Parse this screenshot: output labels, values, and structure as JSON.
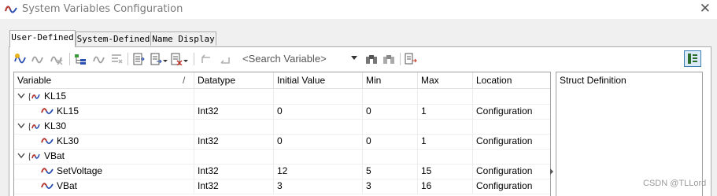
{
  "window": {
    "title": "System Variables Configuration"
  },
  "tabs": [
    {
      "label": "User-Defined",
      "active": true
    },
    {
      "label": "System-Defined",
      "active": false
    },
    {
      "label": "Name Display",
      "active": false
    }
  ],
  "toolbar": {
    "search_placeholder": "<Search Variable>"
  },
  "grid": {
    "columns": [
      "Variable",
      "Datatype",
      "Initial Value",
      "Min",
      "Max",
      "Location"
    ],
    "sort_indicator": "/",
    "rows": [
      {
        "kind": "namespace",
        "name": "KL15",
        "datatype": "",
        "initial": "",
        "min": "",
        "max": "",
        "location": ""
      },
      {
        "kind": "variable",
        "name": "KL15",
        "datatype": "Int32",
        "initial": "0",
        "min": "0",
        "max": "1",
        "location": "Configuration"
      },
      {
        "kind": "namespace",
        "name": "KL30",
        "datatype": "",
        "initial": "",
        "min": "",
        "max": "",
        "location": ""
      },
      {
        "kind": "variable",
        "name": "KL30",
        "datatype": "Int32",
        "initial": "0",
        "min": "0",
        "max": "1",
        "location": "Configuration"
      },
      {
        "kind": "namespace",
        "name": "VBat",
        "datatype": "",
        "initial": "",
        "min": "",
        "max": "",
        "location": ""
      },
      {
        "kind": "variable",
        "name": "SetVoltage",
        "datatype": "Int32",
        "initial": "12",
        "min": "5",
        "max": "15",
        "location": "Configuration"
      },
      {
        "kind": "variable",
        "name": "VBat",
        "datatype": "Int32",
        "initial": "3",
        "min": "3",
        "max": "16",
        "location": "Configuration"
      }
    ]
  },
  "struct_panel": {
    "label": "Struct Definition"
  },
  "watermark": "CSDN @TLLord",
  "colors": {
    "wave_icon": "#c0392b",
    "wave_icon_blue": "#2a4fb0",
    "active_button": "#3c7fb1"
  }
}
